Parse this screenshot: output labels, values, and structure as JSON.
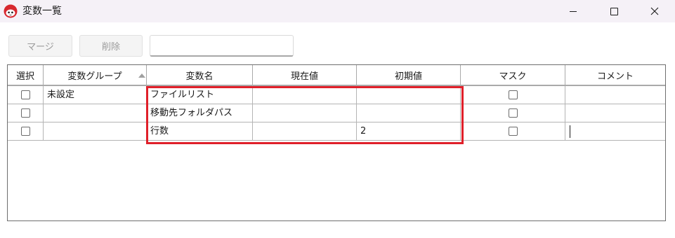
{
  "window": {
    "title": "変数一覧",
    "app_icon": "red-mascot-icon",
    "controls": {
      "minimize": "minimize-icon",
      "maximize": "maximize-icon",
      "close": "close-icon"
    }
  },
  "toolbar": {
    "merge_label": "マージ",
    "delete_label": "削除",
    "search_value": ""
  },
  "table": {
    "columns": [
      "選択",
      "変数グループ",
      "変数名",
      "現在値",
      "初期値",
      "マスク",
      "コメント"
    ],
    "sorted_column": "変数グループ",
    "sort_direction": "ascending",
    "rows": [
      {
        "selected": false,
        "group": "未設定",
        "name": "ファイルリスト",
        "current": "",
        "initial": "",
        "mask": false,
        "comment": ""
      },
      {
        "selected": false,
        "group": "",
        "name": "移動先フォルダパス",
        "current": "",
        "initial": "",
        "mask": false,
        "comment": ""
      },
      {
        "selected": false,
        "group": "",
        "name": "行数",
        "current": "",
        "initial": "2",
        "mask": false,
        "comment": ""
      }
    ]
  },
  "colors": {
    "highlight": "#e0202a",
    "titlebar": "#f5f1f7"
  }
}
